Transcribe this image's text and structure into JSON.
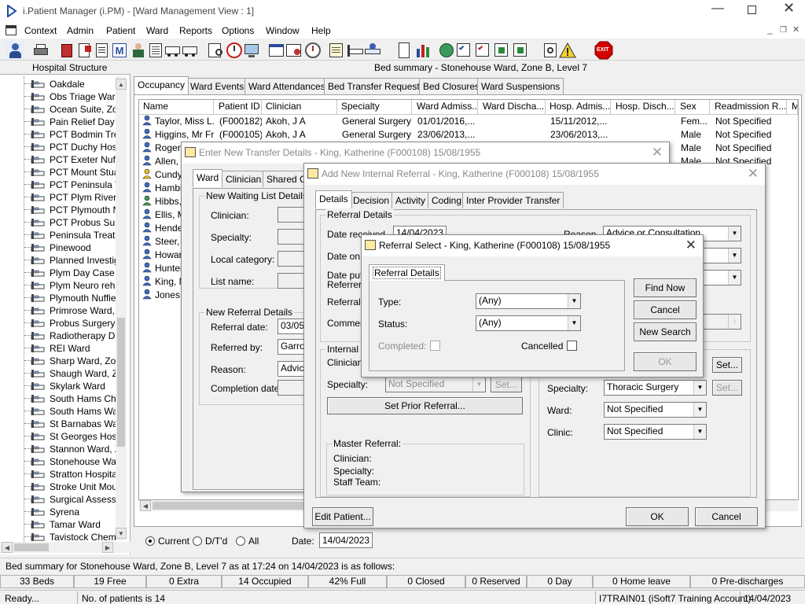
{
  "app": {
    "title": "i.Patient Manager (i.PM) - [Ward Management View : 1]",
    "menu": [
      "Context",
      "Admin",
      "Patient",
      "Ward",
      "Reports",
      "Options",
      "Window",
      "Help"
    ]
  },
  "toolbar": {
    "icons": [
      "person-lookup-icon",
      "printer-icon",
      "book-icon",
      "document-edit-icon",
      "document-icon",
      "m-icon",
      "nurse-icon",
      "document-list-icon",
      "ambulance-icon",
      "ambulance-alt-icon",
      "form-icon",
      "clock-icon",
      "monitor-icon",
      "window-icon",
      "certificate-icon",
      "clock-alt-icon",
      "notes-icon",
      "bed-icon",
      "transfer-icon",
      "page-icon",
      "chart-icon",
      "globe-icon",
      "list-check-icon",
      "list-check-alt-icon",
      "list-arrow-icon",
      "list-arrow-alt-icon",
      "scissors-icon",
      "warning-icon",
      "exit-icon"
    ],
    "exit_label": "EXIT"
  },
  "left_panel": {
    "title": "Hospital Structure",
    "items": [
      "Oakdale",
      "Obs Triage Ward",
      "Ocean Suite, Zor",
      "Pain Relief Day C",
      "PCT Bodmin Trea",
      "PCT Duchy Hosp",
      "PCT Exeter Nuffie",
      "PCT Mount Stuar",
      "PCT Peninsula Tr",
      "PCT Plym River F",
      "PCT Plymouth Nu",
      "PCT Probus Surg",
      "Peninsula Treatm",
      "Pinewood",
      "Planned Investig",
      "Plym Day Case U",
      "Plym Neuro rehab",
      "Plymouth Nuffield",
      "Primrose Ward, Z",
      "Probus Surgery V",
      "Radiotherapy Day",
      "REI Ward",
      "Sharp Ward, Zon",
      "Shaugh Ward, Zo",
      "Skylark Ward",
      "South Hams Cher",
      "South Hams War",
      "St Barnabas War",
      "St Georges Hosp",
      "Stannon Ward, Z",
      "Stonehouse Ward",
      "Stratton Hospital",
      "Stroke Unit Moun",
      "Surgical Assessm",
      "Syrena",
      "Tamar Ward",
      "Tavistock Chemo"
    ]
  },
  "bed_summary_header": "Bed summary - Stonehouse Ward, Zone B, Level 7",
  "ward_tabs": [
    "Occupancy",
    "Ward Events",
    "Ward Attendances",
    "Bed Transfer Requests",
    "Bed Closures",
    "Ward Suspensions"
  ],
  "patients_table": {
    "columns": [
      "Name",
      "Patient ID",
      "Clinician",
      "Specialty",
      "Ward Admiss...",
      "Ward Discha...",
      "Hosp. Admis...",
      "Hosp. Disch...",
      "Sex",
      "Readmission R...",
      "M"
    ],
    "rows": [
      {
        "name": "Taylor, Miss L...",
        "id": "(F000182)",
        "clinician": "Akoh, J A",
        "specialty": "General Surgery",
        "ward_admit": "01/01/2016,...",
        "ward_discharge": "",
        "hosp_admit": "15/11/2012,...",
        "hosp_discharge": "",
        "sex": "Fem...",
        "readmission": "Not Specified"
      },
      {
        "name": "Higgins, Mr Fr...",
        "id": "(F000105)",
        "clinician": "Akoh, J A",
        "specialty": "General Surgery",
        "ward_admit": "23/06/2013,...",
        "ward_discharge": "",
        "hosp_admit": "23/06/2013,...",
        "hosp_discharge": "",
        "sex": "Male",
        "readmission": "Not Specified"
      },
      {
        "name": "Rogers",
        "id": "",
        "clinician": "",
        "specialty": "",
        "ward_admit": "",
        "ward_discharge": "",
        "hosp_admit": "",
        "hosp_discharge": "",
        "sex": "Male",
        "readmission": "Not Specified"
      },
      {
        "name": "Allen, M",
        "id": "",
        "clinician": "",
        "specialty": "",
        "ward_admit": "",
        "ward_discharge": "",
        "hosp_admit": "",
        "hosp_discharge": "",
        "sex": "Male",
        "readmission": "Not Specified"
      },
      {
        "name": "Cundy,",
        "id": "",
        "clinician": "",
        "specialty": "",
        "ward_admit": "",
        "ward_discharge": "",
        "hosp_admit": "",
        "hosp_discharge": "",
        "sex": "",
        "readmission": ""
      },
      {
        "name": "Hamble",
        "id": "",
        "clinician": "",
        "specialty": "",
        "ward_admit": "",
        "ward_discharge": "",
        "hosp_admit": "",
        "hosp_discharge": "",
        "sex": "",
        "readmission": ""
      },
      {
        "name": "Hibbs,",
        "id": "",
        "clinician": "",
        "specialty": "",
        "ward_admit": "",
        "ward_discharge": "",
        "hosp_admit": "",
        "hosp_discharge": "",
        "sex": "",
        "readmission": ""
      },
      {
        "name": "Ellis, M",
        "id": "",
        "clinician": "",
        "specialty": "",
        "ward_admit": "",
        "ward_discharge": "",
        "hosp_admit": "",
        "hosp_discharge": "",
        "sex": "",
        "readmission": ""
      },
      {
        "name": "Hender",
        "id": "",
        "clinician": "",
        "specialty": "",
        "ward_admit": "",
        "ward_discharge": "",
        "hosp_admit": "",
        "hosp_discharge": "",
        "sex": "",
        "readmission": ""
      },
      {
        "name": "Steer, N",
        "id": "",
        "clinician": "",
        "specialty": "",
        "ward_admit": "",
        "ward_discharge": "",
        "hosp_admit": "",
        "hosp_discharge": "",
        "sex": "",
        "readmission": ""
      },
      {
        "name": "Howard",
        "id": "",
        "clinician": "",
        "specialty": "",
        "ward_admit": "",
        "ward_discharge": "",
        "hosp_admit": "",
        "hosp_discharge": "",
        "sex": "",
        "readmission": ""
      },
      {
        "name": "Hunter,",
        "id": "",
        "clinician": "",
        "specialty": "",
        "ward_admit": "",
        "ward_discharge": "",
        "hosp_admit": "",
        "hosp_discharge": "",
        "sex": "",
        "readmission": ""
      },
      {
        "name": "King, M",
        "id": "",
        "clinician": "",
        "specialty": "",
        "ward_admit": "",
        "ward_discharge": "",
        "hosp_admit": "",
        "hosp_discharge": "",
        "sex": "",
        "readmission": ""
      },
      {
        "name": "Jones,",
        "id": "",
        "clinician": "",
        "specialty": "",
        "ward_admit": "",
        "ward_discharge": "",
        "hosp_admit": "",
        "hosp_discharge": "",
        "sex": "",
        "readmission": ""
      }
    ]
  },
  "filter": {
    "current": "Current",
    "dtd": "D/T'd",
    "all": "All",
    "date_label": "Date:",
    "date": "14/04/2023"
  },
  "summary_line": "Bed summary for Stonehouse Ward, Zone B, Level 7 as at 17:24 on 14/04/2023 is as follows:",
  "stats": [
    "33 Beds",
    "19 Free",
    "0 Extra",
    "14 Occupied",
    "42% Full",
    "0 Closed",
    "0 Reserved",
    "0 Day",
    "0 Home leave",
    "0 Pre-discharges"
  ],
  "status_bar": {
    "ready": "Ready...",
    "patients": "No. of patients is 14",
    "user": "I7TRAIN01 (iSoft7 Training Account)",
    "date": "14/04/2023"
  },
  "transfer_dialog": {
    "title": "Enter New Transfer Details - King, Katherine (F000108) 15/08/1955",
    "tabs": [
      "Ward",
      "Clinician",
      "Shared Ca"
    ],
    "waiting_group": "New Waiting List Details",
    "clinician": "Clinician:",
    "specialty": "Specialty:",
    "local_category": "Local category:",
    "list_name": "List name:",
    "referral_group": "New Referral Details",
    "referral_date_label": "Referral date:",
    "referral_date": "03/05/",
    "referred_by_label": "Referred by:",
    "referred_by": "Garrod",
    "reason_label": "Reason:",
    "reason": "Advice",
    "completion_label": "Completion date:"
  },
  "referral_dialog": {
    "title": "Add New Internal Referral - King, Katherine (F000108) 15/08/1955",
    "tabs": [
      "Details",
      "Decision",
      "Activity",
      "Coding",
      "Inter Provider Transfer"
    ],
    "details_group": "Referral Details",
    "date_received_label": "Date received",
    "date_received": "14/04/2023",
    "date_on_label": "Date on",
    "date_put_label": "Date put",
    "referrers_label": "Referrers",
    "referral_label": "Referral",
    "comments_label": "Comments",
    "reason_label": "Reason",
    "reason_value": "Advice or Consultation",
    "internal_group": "Internal Referral",
    "clinician_label": "Clinician:",
    "specialty_label": "Specialty:",
    "specialty_value": "Not Specified",
    "set_label": "Set...",
    "set_prior": "Set Prior Referral...",
    "master_group": "Master Referral:",
    "master_clinician": "Clinician:",
    "master_specialty": "Specialty:",
    "master_staff": "Staff Team:",
    "right_specialty_label": "Specialty:",
    "right_specialty": "Thoracic Surgery",
    "ward_label": "Ward:",
    "ward_value": "Not Specified",
    "clinic_label": "Clinic:",
    "clinic_value": "Not Specified",
    "edit_patient": "Edit Patient...",
    "ok": "OK",
    "cancel": "Cancel"
  },
  "select_dialog": {
    "title": "Referral Select - King, Katherine (F000108) 15/08/1955",
    "tab": "Referral Details",
    "type_label": "Type:",
    "type_value": "(Any)",
    "status_label": "Status:",
    "status_value": "(Any)",
    "completed_label": "Completed:",
    "cancelled_label": "Cancelled",
    "find_now": "Find Now",
    "cancel": "Cancel",
    "new_search": "New Search",
    "ok": "OK"
  },
  "colors": {
    "accent": "#0078d7",
    "exit_red": "#d40000",
    "window_bg": "#f0f0f0"
  }
}
